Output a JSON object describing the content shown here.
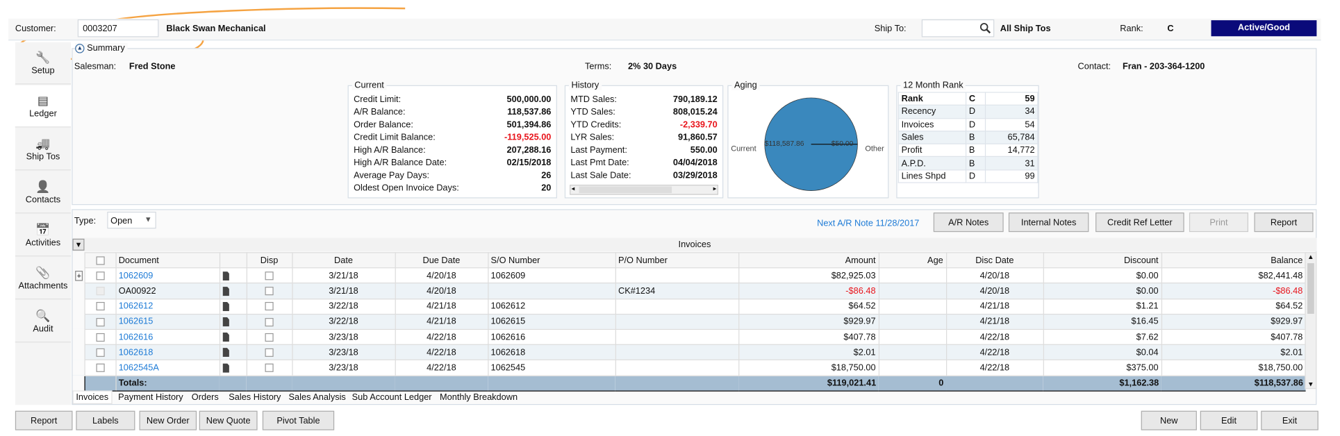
{
  "header": {
    "customer_label": "Customer:",
    "customer_id": "0003207",
    "customer_name": "Black Swan Mechanical",
    "ship_to_label": "Ship To:",
    "ship_to_value": "",
    "ship_to_name": "All Ship Tos",
    "rank_label": "Rank:",
    "rank_value": "C",
    "status": "Active/Good",
    "status_color": "#0a0a7a",
    "annotation_color": "#f5a342"
  },
  "sidebar": {
    "items": [
      {
        "label": "Setup",
        "icon": "wrench-icon"
      },
      {
        "label": "Ledger",
        "icon": "ledger-icon",
        "active": true
      },
      {
        "label": "Ship Tos",
        "icon": "truck-icon"
      },
      {
        "label": "Contacts",
        "icon": "person-icon"
      },
      {
        "label": "Activities",
        "icon": "calendar-icon"
      },
      {
        "label": "Attachments",
        "icon": "paperclip-icon"
      },
      {
        "label": "Audit",
        "icon": "search-icon"
      }
    ]
  },
  "summary": {
    "title": "Summary",
    "salesman_label": "Salesman:",
    "salesman": "Fred Stone",
    "terms_label": "Terms:",
    "terms": "2% 30 Days",
    "contact_label": "Contact:",
    "contact": "Fran - 203-364-1200",
    "current": {
      "title": "Current",
      "rows": [
        {
          "label": "Credit Limit:",
          "value": "500,000.00"
        },
        {
          "label": "A/R Balance:",
          "value": "118,537.86"
        },
        {
          "label": "Order Balance:",
          "value": "501,394.86"
        },
        {
          "label": "Credit Limit Balance:",
          "value": "-119,525.00",
          "negative": true
        },
        {
          "label": "High A/R Balance:",
          "value": "207,288.16"
        },
        {
          "label": "High A/R Balance Date:",
          "value": "02/15/2018"
        },
        {
          "label": "Average Pay Days:",
          "value": "26"
        },
        {
          "label": "Oldest Open Invoice Days:",
          "value": "20"
        }
      ]
    },
    "history": {
      "title": "History",
      "rows": [
        {
          "label": "MTD Sales:",
          "value": "790,189.12"
        },
        {
          "label": "YTD Sales:",
          "value": "808,015.24"
        },
        {
          "label": "YTD Credits:",
          "value": "-2,339.70",
          "negative": true
        },
        {
          "label": "LYR Sales:",
          "value": "91,860.57"
        },
        {
          "label": "Last Payment:",
          "value": "550.00"
        },
        {
          "label": "Last Pmt Date:",
          "value": "04/04/2018"
        },
        {
          "label": "Last Sale Date:",
          "value": "03/29/2018"
        }
      ]
    },
    "aging": {
      "title": "Aging",
      "left_label": "Current",
      "right_label": "Other",
      "current_value": "$118,587.86",
      "other_value": "$50.00",
      "pie_color": "#3a88bd"
    },
    "rank": {
      "title": "12 Month Rank",
      "rows": [
        [
          "Rank",
          "C",
          "59"
        ],
        [
          "Recency",
          "D",
          "34"
        ],
        [
          "Invoices",
          "D",
          "54"
        ],
        [
          "Sales",
          "B",
          "65,784"
        ],
        [
          "Profit",
          "B",
          "14,772"
        ],
        [
          "A.P.D.",
          "B",
          "31"
        ],
        [
          "Lines Shpd",
          "D",
          "99"
        ]
      ]
    }
  },
  "ledger": {
    "type_label": "Type:",
    "type_value": "Open",
    "next_note": "Next A/R Note 11/28/2017",
    "buttons": [
      "A/R Notes",
      "Internal Notes",
      "Credit Ref Letter",
      "Print",
      "Report"
    ],
    "grid_title": "Invoices",
    "columns": [
      "Document",
      "",
      "Disp",
      "Date",
      "Due Date",
      "S/O Number",
      "P/O Number",
      "Amount",
      "Age",
      "Disc Date",
      "Discount",
      "Balance"
    ],
    "rows": [
      {
        "doc": "1062609",
        "link": true,
        "expand": true,
        "date": "3/21/18",
        "due": "4/20/18",
        "so": "1062609",
        "po": "",
        "amount": "$82,925.03",
        "age": "",
        "disc_date": "4/20/18",
        "discount": "$0.00",
        "balance": "$82,441.48"
      },
      {
        "doc": "OA00922",
        "link": false,
        "disabled": true,
        "date": "3/21/18",
        "due": "4/20/18",
        "so": "",
        "po": "CK#1234",
        "amount": "-$86.48",
        "neg": true,
        "age": "",
        "disc_date": "4/20/18",
        "discount": "$0.00",
        "balance": "-$86.48"
      },
      {
        "doc": "1062612",
        "link": true,
        "date": "3/22/18",
        "due": "4/21/18",
        "so": "1062612",
        "po": "",
        "amount": "$64.52",
        "age": "",
        "disc_date": "4/21/18",
        "discount": "$1.21",
        "balance": "$64.52"
      },
      {
        "doc": "1062615",
        "link": true,
        "date": "3/22/18",
        "due": "4/21/18",
        "so": "1062615",
        "po": "",
        "amount": "$929.97",
        "age": "",
        "disc_date": "4/21/18",
        "discount": "$16.45",
        "balance": "$929.97"
      },
      {
        "doc": "1062616",
        "link": true,
        "date": "3/23/18",
        "due": "4/22/18",
        "so": "1062616",
        "po": "",
        "amount": "$407.78",
        "age": "",
        "disc_date": "4/22/18",
        "discount": "$7.62",
        "balance": "$407.78"
      },
      {
        "doc": "1062618",
        "link": true,
        "date": "3/23/18",
        "due": "4/22/18",
        "so": "1062618",
        "po": "",
        "amount": "$2.01",
        "age": "",
        "disc_date": "4/22/18",
        "discount": "$0.04",
        "balance": "$2.01"
      },
      {
        "doc": "1062545A",
        "link": true,
        "date": "3/23/18",
        "due": "4/22/18",
        "so": "1062545",
        "po": "",
        "amount": "$18,750.00",
        "age": "",
        "disc_date": "4/22/18",
        "discount": "$375.00",
        "balance": "$18,750.00"
      }
    ],
    "totals": {
      "label": "Totals:",
      "amount": "$119,021.41",
      "age": "0",
      "discount": "$1,162.38",
      "balance": "$118,537.86"
    },
    "tabs": [
      "Invoices",
      "Payment History",
      "Orders",
      "Sales History",
      "Sales Analysis",
      "Sub Account Ledger",
      "Monthly Breakdown"
    ]
  },
  "footer": {
    "left_buttons": [
      "Report",
      "Labels",
      "New Order",
      "New Quote",
      "Pivot Table"
    ],
    "right_buttons": [
      "New",
      "Edit",
      "Exit"
    ]
  }
}
